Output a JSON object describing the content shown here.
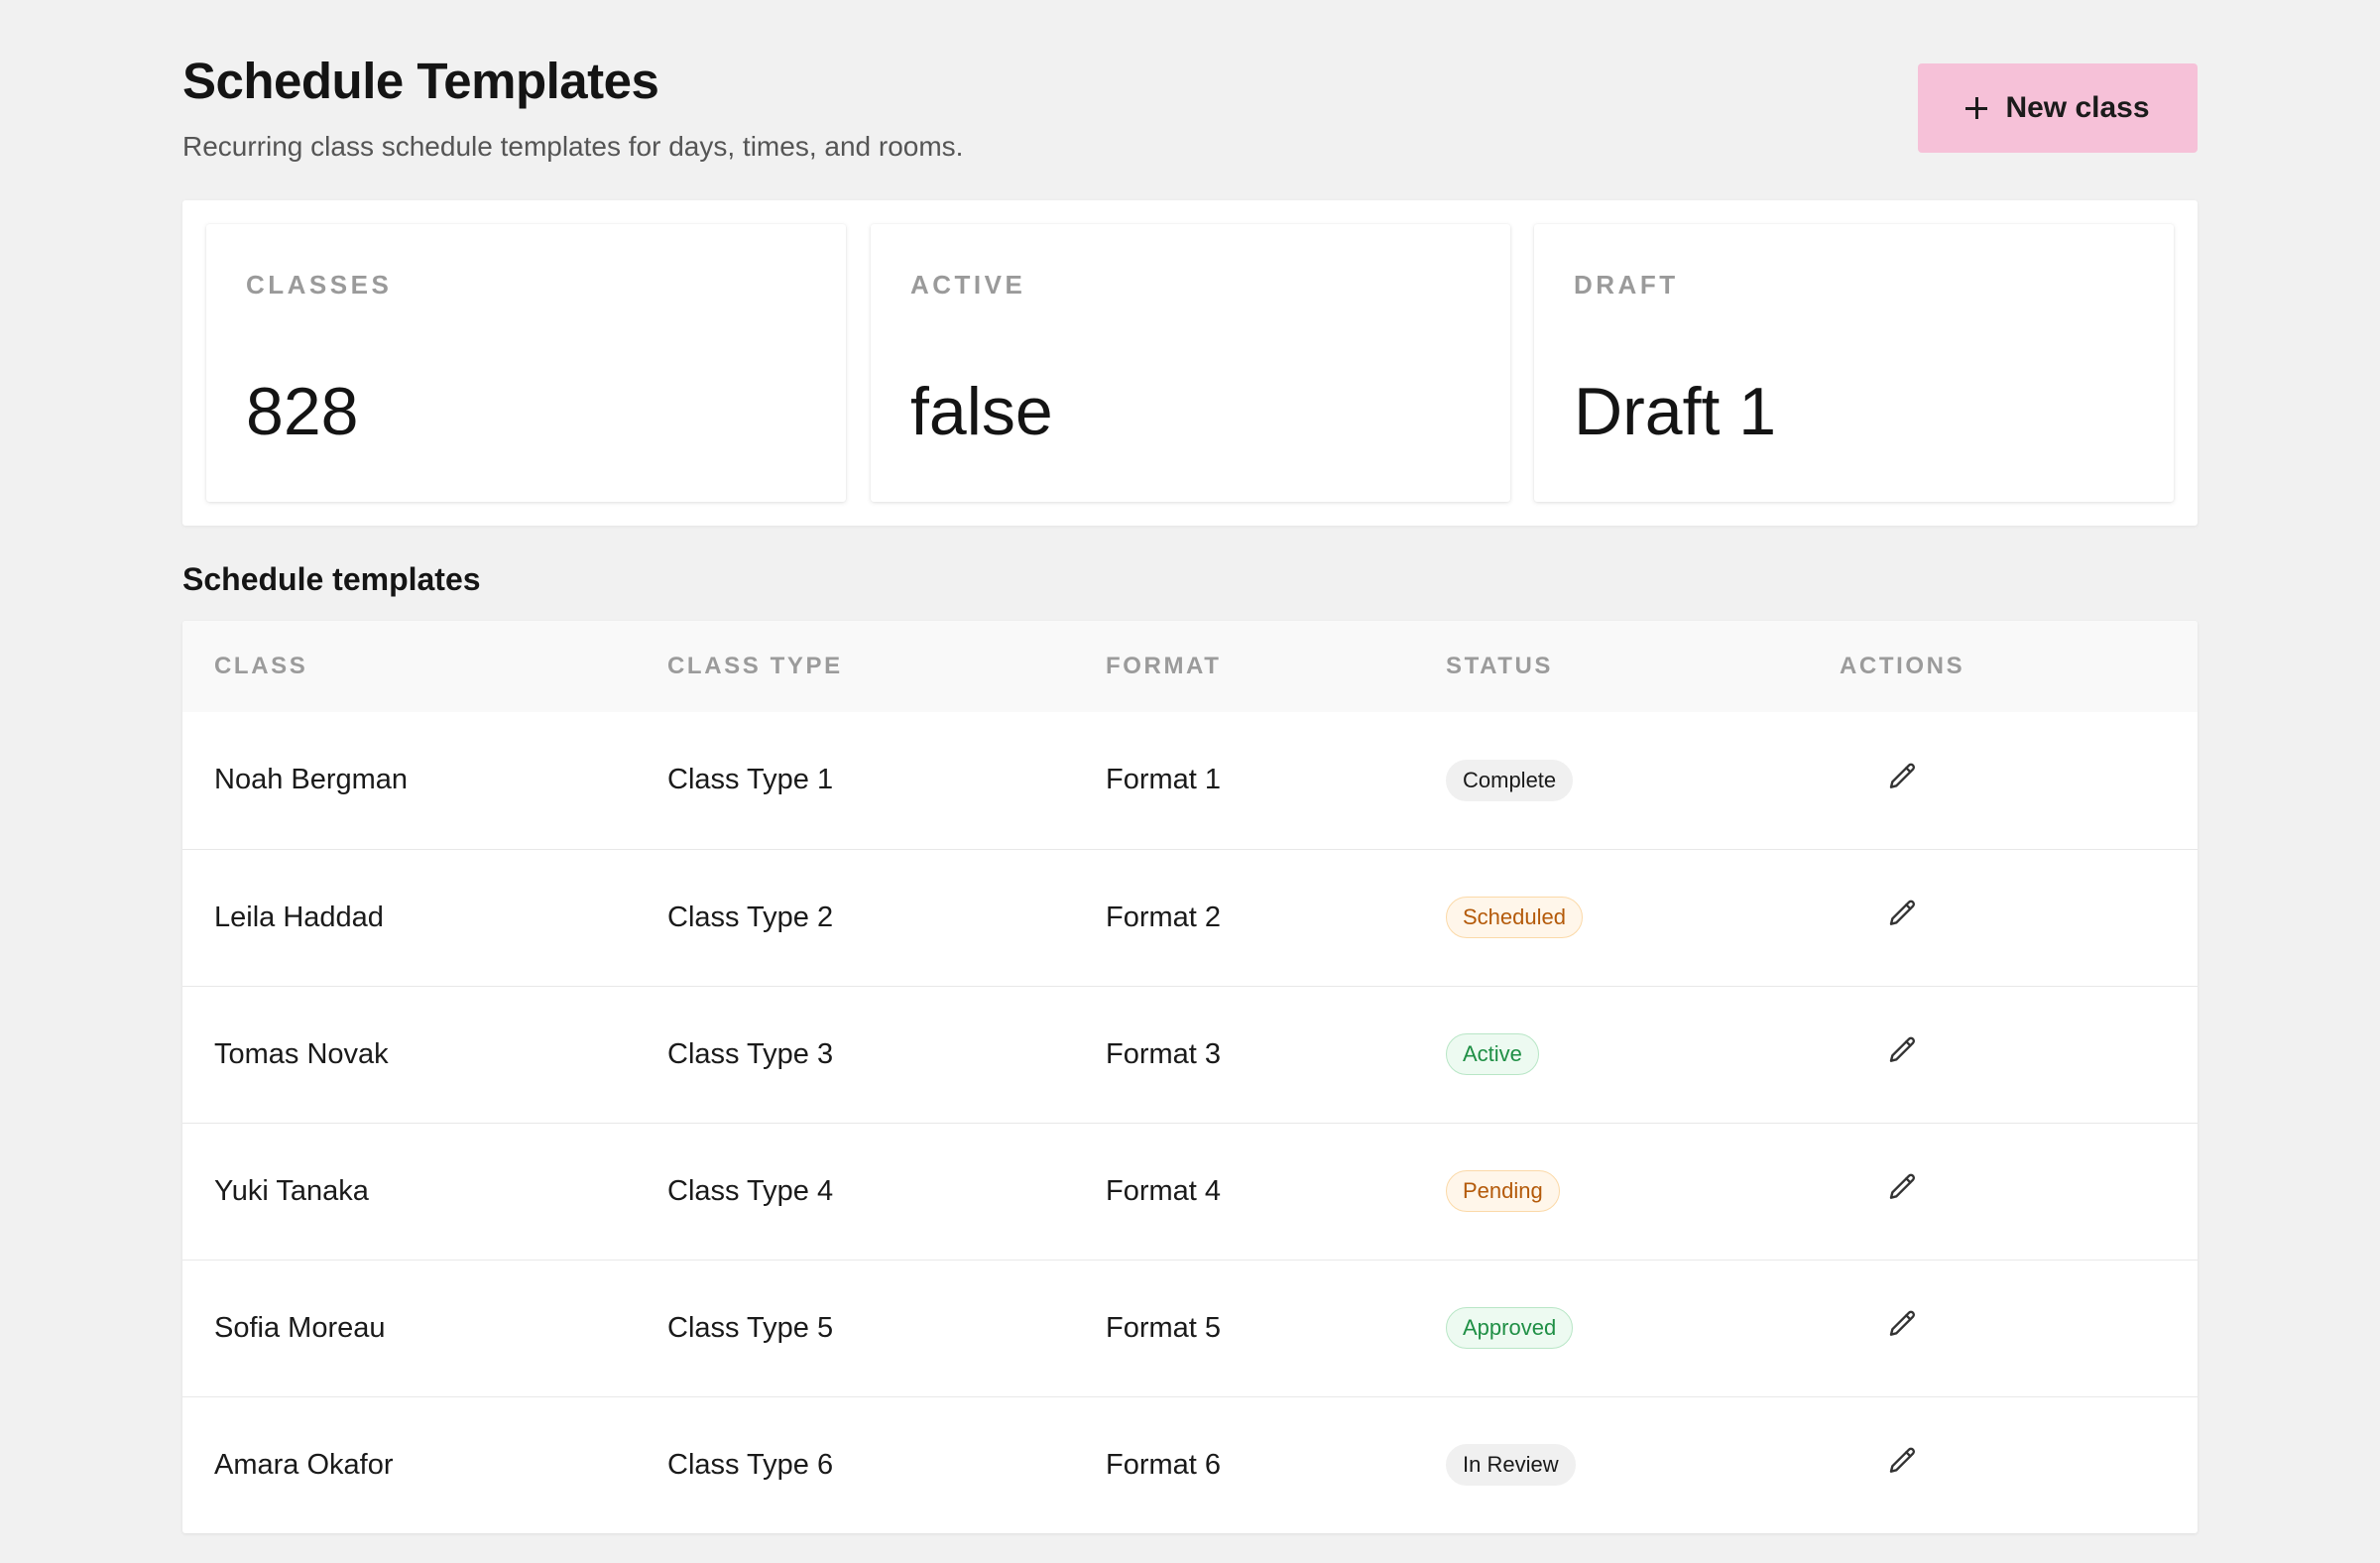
{
  "header": {
    "title": "Schedule Templates",
    "subtitle": "Recurring class schedule templates for days, times, and rooms.",
    "new_button_label": "New class",
    "new_button_icon": "plus-icon",
    "new_button_color": "#f6c1d8"
  },
  "stats": [
    {
      "label": "CLASSES",
      "value": "828"
    },
    {
      "label": "ACTIVE",
      "value": "false"
    },
    {
      "label": "DRAFT",
      "value": "Draft 1"
    }
  ],
  "table": {
    "section_title": "Schedule templates",
    "columns": [
      "CLASS",
      "CLASS TYPE",
      "FORMAT",
      "STATUS",
      "ACTIONS"
    ],
    "action_icon": "pencil-icon",
    "rows": [
      {
        "class": "Noah Bergman",
        "class_type": "Class Type 1",
        "format": "Format 1",
        "status": "Complete",
        "status_tone": "neutral"
      },
      {
        "class": "Leila Haddad",
        "class_type": "Class Type 2",
        "format": "Format 2",
        "status": "Scheduled",
        "status_tone": "warn"
      },
      {
        "class": "Tomas Novak",
        "class_type": "Class Type 3",
        "format": "Format 3",
        "status": "Active",
        "status_tone": "success"
      },
      {
        "class": "Yuki Tanaka",
        "class_type": "Class Type 4",
        "format": "Format 4",
        "status": "Pending",
        "status_tone": "warn"
      },
      {
        "class": "Sofia Moreau",
        "class_type": "Class Type 5",
        "format": "Format 5",
        "status": "Approved",
        "status_tone": "success"
      },
      {
        "class": "Amara Okafor",
        "class_type": "Class Type 6",
        "format": "Format 6",
        "status": "In Review",
        "status_tone": "neutral"
      }
    ]
  },
  "colors": {
    "page_background": "#f1f1f1",
    "warn_text": "#b45a0a",
    "success_text": "#1f8f45"
  }
}
